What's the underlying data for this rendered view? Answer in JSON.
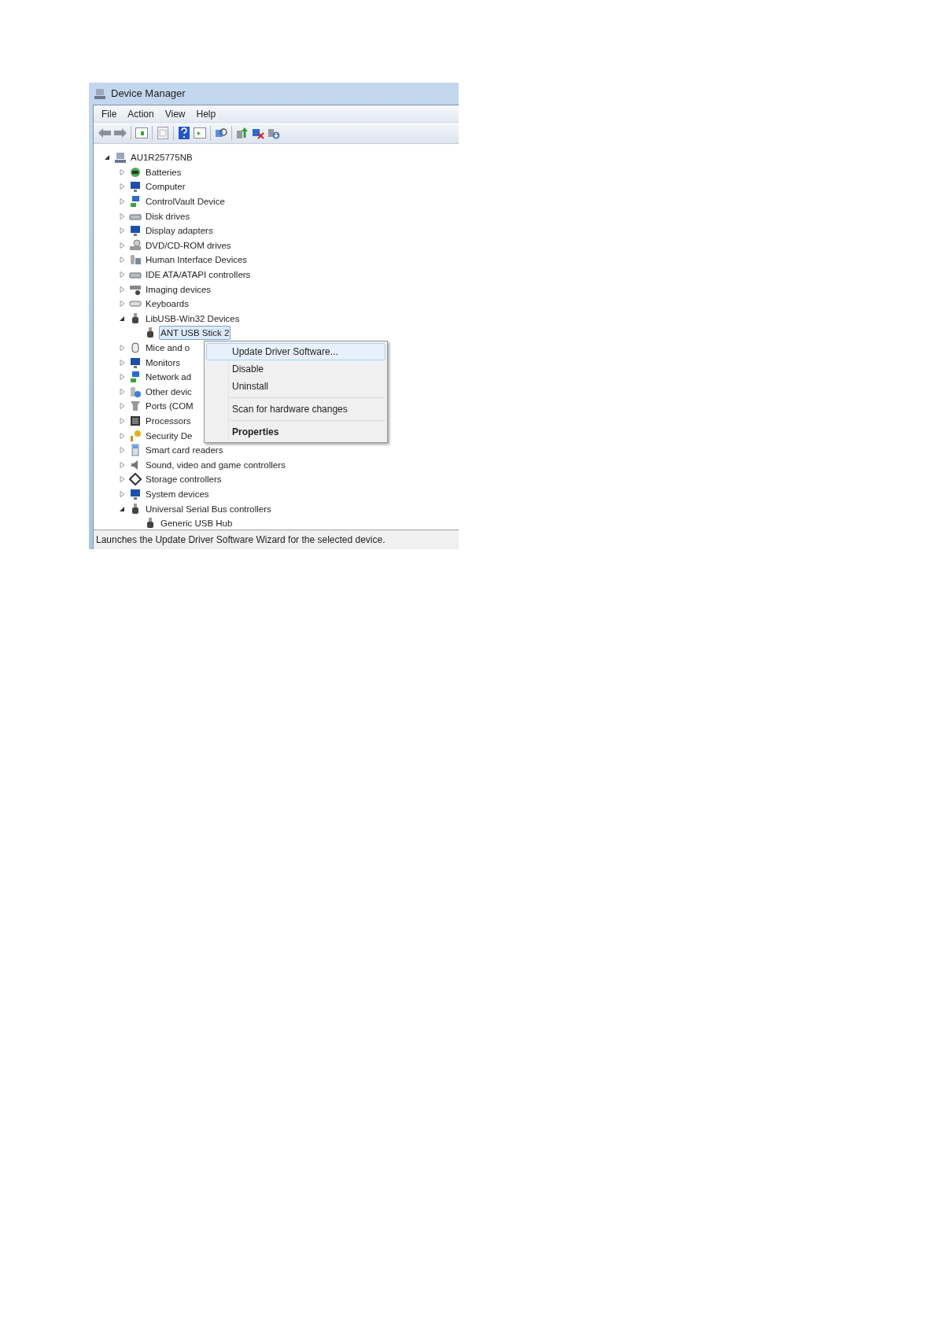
{
  "window": {
    "title": "Device Manager"
  },
  "menu_bar": [
    "File",
    "Action",
    "View",
    "Help"
  ],
  "tree": {
    "root": {
      "label": "AU1R25775NB",
      "expanded": true,
      "selected": false,
      "children": [
        {
          "label": "Batteries",
          "expanded": false,
          "selected": false
        },
        {
          "label": "Computer",
          "expanded": false,
          "selected": false
        },
        {
          "label": "ControlVault Device",
          "expanded": false,
          "selected": false
        },
        {
          "label": "Disk drives",
          "expanded": false,
          "selected": false
        },
        {
          "label": "Display adapters",
          "expanded": false,
          "selected": false
        },
        {
          "label": "DVD/CD-ROM drives",
          "expanded": false,
          "selected": false
        },
        {
          "label": "Human Interface Devices",
          "expanded": false,
          "selected": false
        },
        {
          "label": "IDE ATA/ATAPI controllers",
          "expanded": false,
          "selected": false
        },
        {
          "label": "Imaging devices",
          "expanded": false,
          "selected": false
        },
        {
          "label": "Keyboards",
          "expanded": false,
          "selected": false
        },
        {
          "label": "LibUSB-Win32 Devices",
          "expanded": true,
          "selected": false,
          "children": [
            {
              "label": "ANT USB Stick 2",
              "selected": true
            }
          ]
        },
        {
          "label": "Mice and o",
          "expanded": false,
          "selected": false
        },
        {
          "label": "Monitors",
          "expanded": false,
          "selected": false
        },
        {
          "label": "Network ad",
          "expanded": false,
          "selected": false
        },
        {
          "label": "Other devic",
          "expanded": false,
          "selected": false
        },
        {
          "label": "Ports (COM",
          "expanded": false,
          "selected": false
        },
        {
          "label": "Processors",
          "expanded": false,
          "selected": false
        },
        {
          "label": "Security De",
          "expanded": false,
          "selected": false
        },
        {
          "label": "Smart card readers",
          "expanded": false,
          "selected": false
        },
        {
          "label": "Sound, video and game controllers",
          "expanded": false,
          "selected": false
        },
        {
          "label": "Storage controllers",
          "expanded": false,
          "selected": false
        },
        {
          "label": "System devices",
          "expanded": false,
          "selected": false
        },
        {
          "label": "Universal Serial Bus controllers",
          "expanded": true,
          "selected": false,
          "children": [
            {
              "label": "Generic USB Hub",
              "selected": false
            }
          ]
        }
      ]
    }
  },
  "context_menu": {
    "groups": [
      {
        "items": [
          {
            "label": "Update Driver Software...",
            "selected": true,
            "default": false
          },
          {
            "label": "Disable",
            "selected": false,
            "default": false
          },
          {
            "label": "Uninstall",
            "selected": false,
            "default": false
          }
        ]
      },
      {
        "items": [
          {
            "label": "Scan for hardware changes",
            "selected": false,
            "default": false
          }
        ]
      },
      {
        "items": [
          {
            "label": "Properties",
            "selected": false,
            "default": true
          }
        ]
      }
    ]
  },
  "status_bar": "Launches the Update Driver Software Wizard for the selected device."
}
